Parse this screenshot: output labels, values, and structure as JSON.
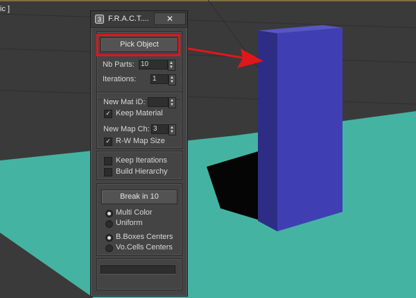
{
  "viewport": {
    "label": "ic ]",
    "colors": {
      "background": "#3a3a3a",
      "floor": "#45b3a2",
      "box_front": "#3e3eb2",
      "box_side": "#2d2d86",
      "box_top": "#5a5ac8",
      "shadow": "#000000"
    }
  },
  "dialog": {
    "title": "F.R.A.C.T....",
    "close_glyph": "✕",
    "pick_object_label": "Pick Object",
    "nb_parts": {
      "label": "Nb Parts:",
      "value": "10"
    },
    "iterations": {
      "label": "Iterations:",
      "value": "1"
    },
    "new_mat_id": {
      "label": "New Mat ID:",
      "value": ""
    },
    "keep_material": {
      "label": "Keep Material",
      "checked": true,
      "glyph": "✓"
    },
    "new_map_ch": {
      "label": "New Map Ch:",
      "value": "3"
    },
    "rw_map_size": {
      "label": "R-W Map Size",
      "checked": true,
      "glyph": "✓"
    },
    "keep_iterations": {
      "label": "Keep Iterations",
      "checked": false
    },
    "build_hierarchy": {
      "label": "Build Hierarchy",
      "checked": false
    },
    "break_label": "Break in 10",
    "multi_color": {
      "label": "Multi Color",
      "selected": true
    },
    "uniform": {
      "label": "Uniform",
      "selected": false
    },
    "bboxes_centers": {
      "label": "B.Boxes Centers",
      "selected": true
    },
    "vocells_centers": {
      "label": "Vo.Cells Centers",
      "selected": false
    },
    "progress": 0
  },
  "annotation": {
    "color": "#e1161b"
  }
}
